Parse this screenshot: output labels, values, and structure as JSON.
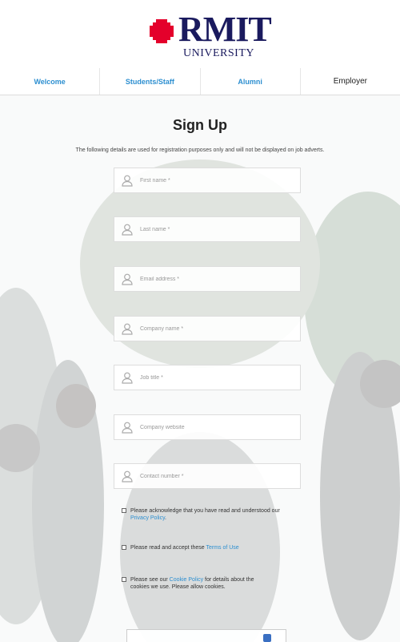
{
  "brand": {
    "name": "RMIT",
    "sub": "UNIVERSITY",
    "color": "#1a1a5e",
    "accent": "#e4002b"
  },
  "nav": {
    "tabs": [
      "Welcome",
      "Students/Staff",
      "Alumni",
      "Employer"
    ]
  },
  "form": {
    "title": "Sign Up",
    "subtitle": "The following details are used for registration purposes only and will not be displayed on job adverts.",
    "fields": [
      {
        "placeholder": "First name *"
      },
      {
        "placeholder": "Last name *"
      },
      {
        "placeholder": "Email address *"
      },
      {
        "placeholder": "Company name *"
      },
      {
        "placeholder": "Job title *"
      },
      {
        "placeholder": "Company website"
      },
      {
        "placeholder": "Contact number *"
      }
    ],
    "checkboxes": [
      {
        "before": "Please acknowledge that you have read and understood our ",
        "link": "Privacy Policy",
        "after": "."
      },
      {
        "before": "Please read and accept these ",
        "link": "Terms of Use",
        "after": ""
      },
      {
        "before": "Please see our ",
        "link": "Cookie Policy",
        "after": " for details about the cookies we use. Please allow cookies."
      }
    ]
  }
}
